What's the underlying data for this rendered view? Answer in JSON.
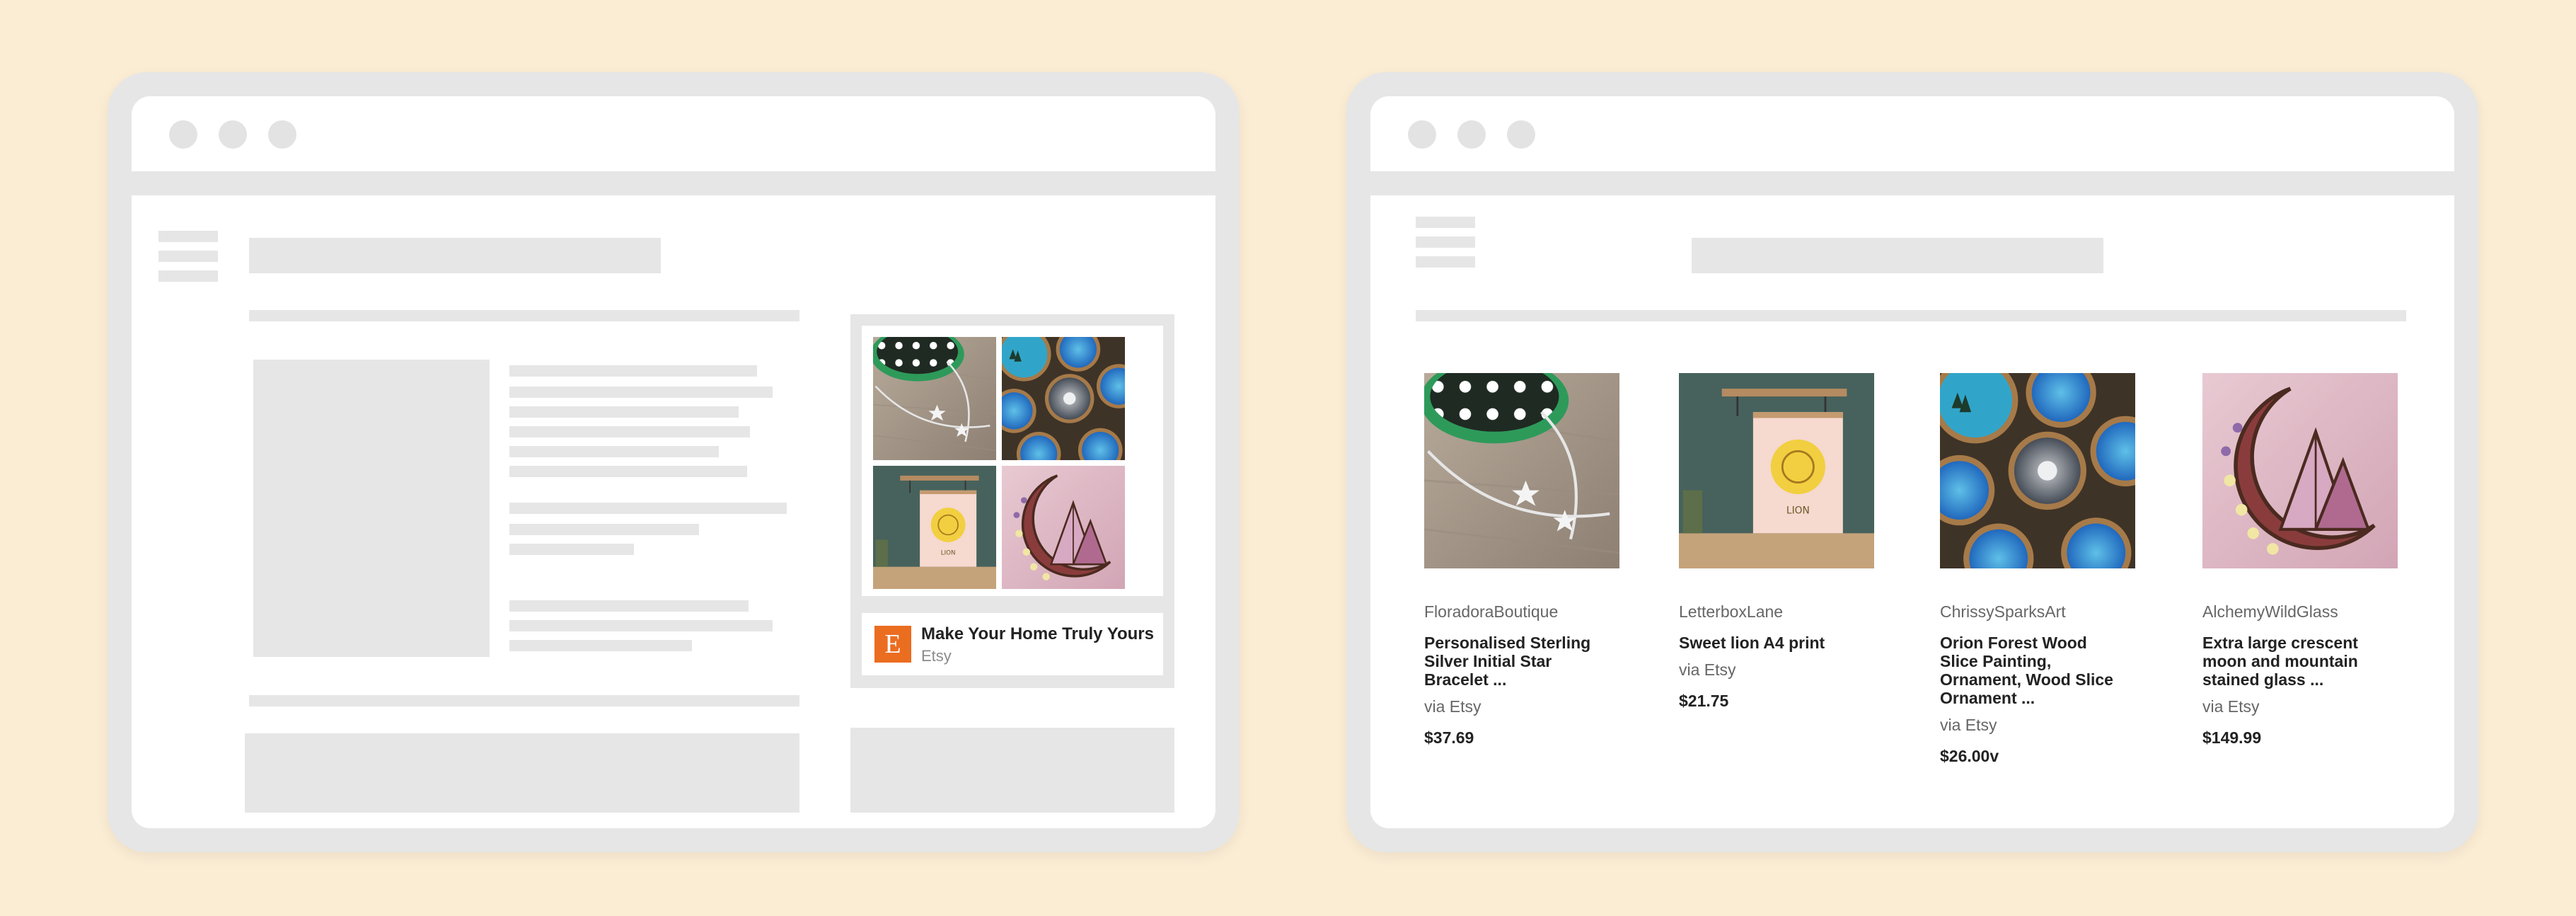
{
  "ad": {
    "title": "Make Your Home Truly Yours",
    "subtitle": "Etsy",
    "logo_letter": "E",
    "logo_color": "#eb6d20"
  },
  "products": [
    {
      "shop": "FloradoraBoutique",
      "title": "Personalised Sterling Silver Initial Star Bracelet ...",
      "via": "via Etsy",
      "price": "$37.69",
      "image": "silver-star-bracelet"
    },
    {
      "shop": "LetterboxLane",
      "title": "Sweet lion A4 print",
      "via": "via Etsy",
      "price": "$21.75",
      "image": "lion-print"
    },
    {
      "shop": "ChrissySparksArt",
      "title": "Orion Forest Wood Slice Painting, Ornament, Wood Slice Ornament ...",
      "via": "via Etsy",
      "price": "$26.00v",
      "image": "wood-slice-paintings"
    },
    {
      "shop": "AlchemyWildGlass",
      "title": "Extra large crescent moon and mountain stained glass ...",
      "via": "via Etsy",
      "price": "$149.99",
      "image": "stained-glass-moon"
    }
  ],
  "colors": {
    "background": "#fbecd4",
    "frame": "#e6e6e6",
    "placeholder": "#e6e6e6"
  }
}
